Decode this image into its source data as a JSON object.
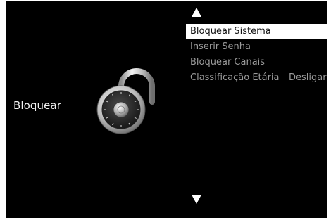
{
  "section": {
    "label": "Bloquear",
    "icon": "padlock-dial-icon"
  },
  "menu": {
    "items": [
      {
        "label": "Bloquear Sistema",
        "selected": true
      },
      {
        "label": "Inserir Senha",
        "selected": false
      },
      {
        "label": "Bloquear Canais",
        "selected": false
      },
      {
        "label": "Classificação Etária",
        "value": "Desligar",
        "selected": false
      }
    ],
    "scroll_up_icon": "arrow-up-icon",
    "scroll_down_icon": "arrow-down-icon"
  },
  "colors": {
    "background": "#000000",
    "text": "#f2f2f2",
    "inactive_item": "#9a9a9a",
    "highlight": "#ffffff"
  }
}
